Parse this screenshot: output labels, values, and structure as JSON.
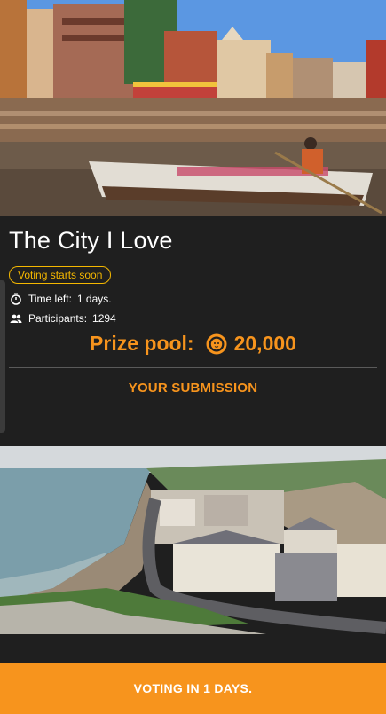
{
  "contest": {
    "title": "The City I Love",
    "status_badge": "Voting starts soon",
    "time_left_label": "Time left:",
    "time_left_value": "1 days.",
    "participants_label": "Participants:",
    "participants_value": "1294",
    "prize_label": "Prize pool:",
    "prize_value": "20,000",
    "submission_label": "YOUR SUBMISSION"
  },
  "footer": {
    "cta_label": "VOTING IN 1 DAYS."
  },
  "icons": {
    "time": "stopwatch-icon",
    "participants": "people-icon",
    "prize": "lion-coin-icon"
  },
  "colors": {
    "accent_orange": "#f7941d",
    "badge_yellow": "#f5b800",
    "background": "#1f1f1f"
  }
}
